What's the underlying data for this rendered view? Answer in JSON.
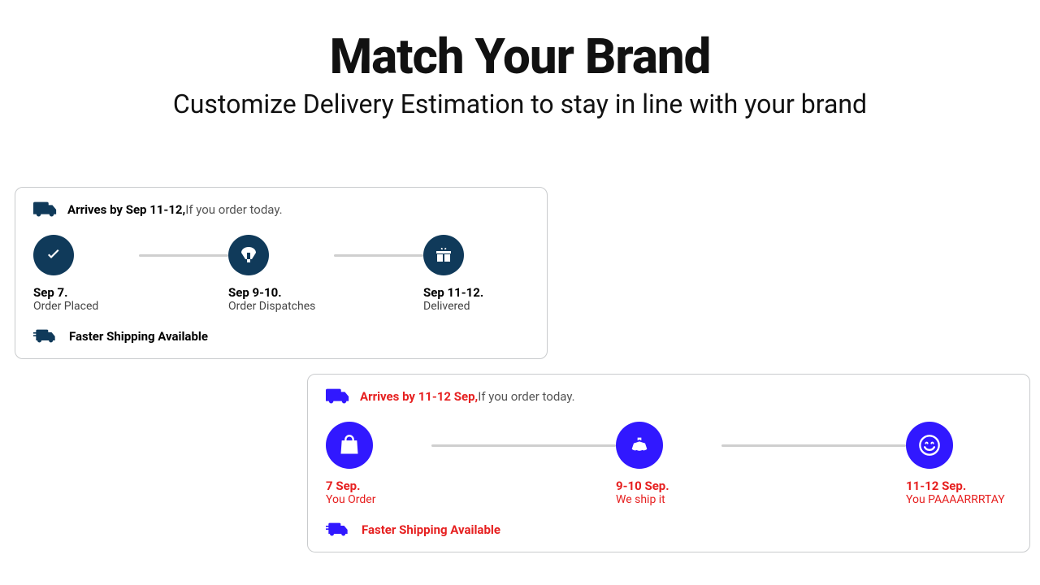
{
  "hero": {
    "title": "Match Your Brand",
    "subtitle": "Customize Delivery Estimation to stay in line with your brand"
  },
  "card_a": {
    "top_bold": "Arrives by Sep 11-12,",
    "top_rest": "If you order today.",
    "steps": [
      {
        "icon": "check-icon",
        "date": "Sep 7.",
        "desc": "Order Placed"
      },
      {
        "icon": "parachute-icon",
        "date": "Sep 9-10.",
        "desc": "Order Dispatches"
      },
      {
        "icon": "gift-icon",
        "date": "Sep 11-12.",
        "desc": "Delivered"
      }
    ],
    "footer": "Faster Shipping Available"
  },
  "card_b": {
    "top_bold": "Arrives by 11-12 Sep,",
    "top_rest": "If you order today.",
    "steps": [
      {
        "icon": "bag-icon",
        "date": "7 Sep.",
        "desc": "You Order"
      },
      {
        "icon": "ship-icon",
        "date": "9-10 Sep.",
        "desc": "We ship it"
      },
      {
        "icon": "smile-icon",
        "date": "11-12 Sep.",
        "desc": "You PAAAARRRTAY"
      }
    ],
    "footer": "Faster Shipping Available"
  },
  "colors": {
    "a_accent": "#103a5a",
    "b_circle": "#3118ff",
    "b_text": "#e62020"
  }
}
